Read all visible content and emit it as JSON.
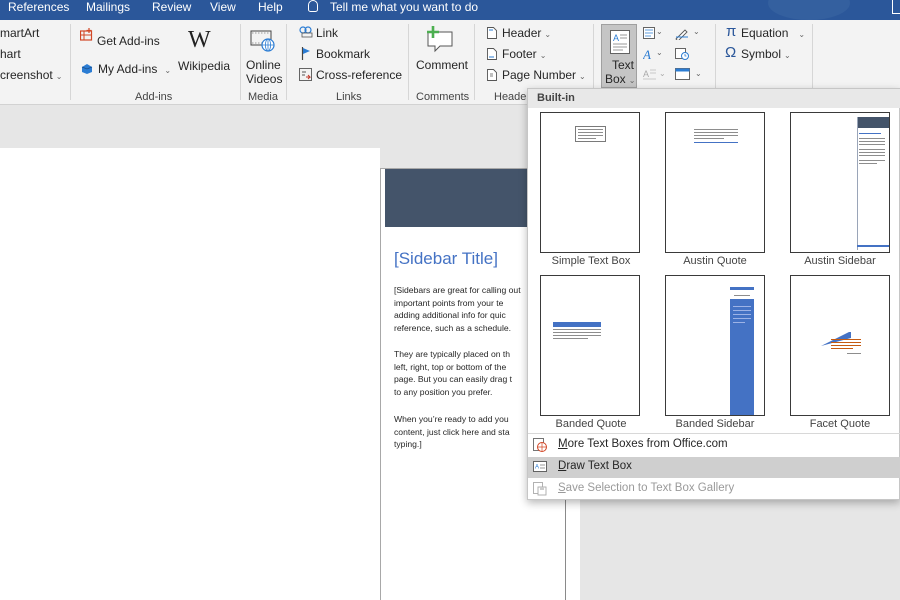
{
  "tabs": {
    "items": [
      "References",
      "Mailings",
      "Review",
      "View",
      "Help"
    ],
    "tell_me": "Tell me what you want to do"
  },
  "ribbon": {
    "illustrations": {
      "smartart": "martArt",
      "chart": "hart",
      "screenshot": "creenshot"
    },
    "addins": {
      "get": "Get Add-ins",
      "my": "My Add-ins",
      "wikipedia": "Wikipedia",
      "group": "Add-ins"
    },
    "media": {
      "online_videos_1": "Online",
      "online_videos_2": "Videos",
      "group": "Media"
    },
    "links": {
      "link": "Link",
      "bookmark": "Bookmark",
      "cross_reference": "Cross-reference",
      "group": "Links"
    },
    "comments": {
      "comment": "Comment",
      "group": "Comments"
    },
    "header_footer": {
      "header": "Header",
      "footer": "Footer",
      "page_number": "Page Number",
      "group": "Header"
    },
    "text": {
      "text_box_1": "Text",
      "text_box_2": "Box"
    },
    "symbols": {
      "equation": "Equation",
      "symbol": "Symbol"
    },
    "wikipedia_glyph": "W",
    "pi_glyph": "π",
    "omega_glyph": "Ω",
    "caret": "⌄"
  },
  "document": {
    "sidebar_title": "[Sidebar Title]",
    "para1": "[Sidebars are great for calling out\nimportant points from your te\nadding additional info for quic\nreference, such as a schedule.",
    "para2": "They are typically placed on th\nleft, right, top or bottom of the\npage. But you can easily drag t\nto any position you prefer.",
    "para3": "When you’re ready to add you\ncontent, just click here and sta\ntyping.]"
  },
  "dropdown": {
    "section": "Built-in",
    "gallery": [
      "Simple Text Box",
      "Austin Quote",
      "Austin Sidebar",
      "Banded Quote",
      "Banded Sidebar",
      "Facet Quote"
    ],
    "more": {
      "key": "M",
      "rest": "ore Text Boxes from Office.com"
    },
    "draw": {
      "key": "D",
      "rest": "raw Text Box"
    },
    "save": {
      "key": "S",
      "rest": "ave Selection to Text Box Gallery"
    }
  },
  "colors": {
    "accent": "#2b579a",
    "sidebar_header": "#44546a",
    "sidebar_title": "#4472c4",
    "banded_blue": "#4472c4",
    "facet_orange": "#c55a11"
  }
}
